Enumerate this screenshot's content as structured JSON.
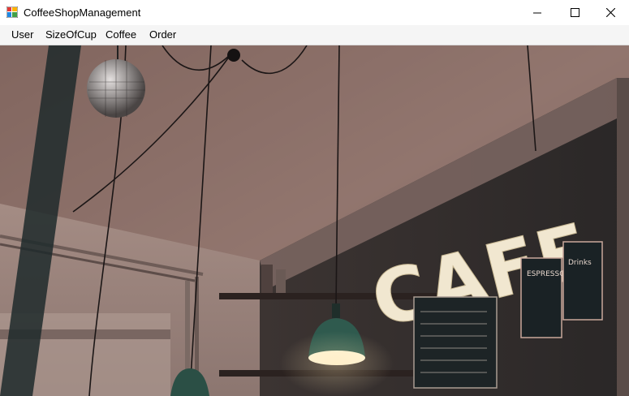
{
  "window": {
    "title": "CoffeeShopManagement",
    "icon": "app-icon",
    "controls": [
      "minimize-icon",
      "maximize-icon",
      "close-icon"
    ]
  },
  "menu": {
    "items": [
      {
        "label": "User"
      },
      {
        "label": "SizeOfCup"
      },
      {
        "label": "Coffee"
      },
      {
        "label": "Order"
      }
    ]
  },
  "background": {
    "sign_text": "CAFE",
    "board_left_text": "ESPRESSO",
    "board_right_title": "Drinks",
    "colors": {
      "wall": "#a88e86",
      "ceiling": "#8f6f67",
      "lamp_green": "#2f5a4e",
      "bulb": "#fff4d6"
    }
  }
}
